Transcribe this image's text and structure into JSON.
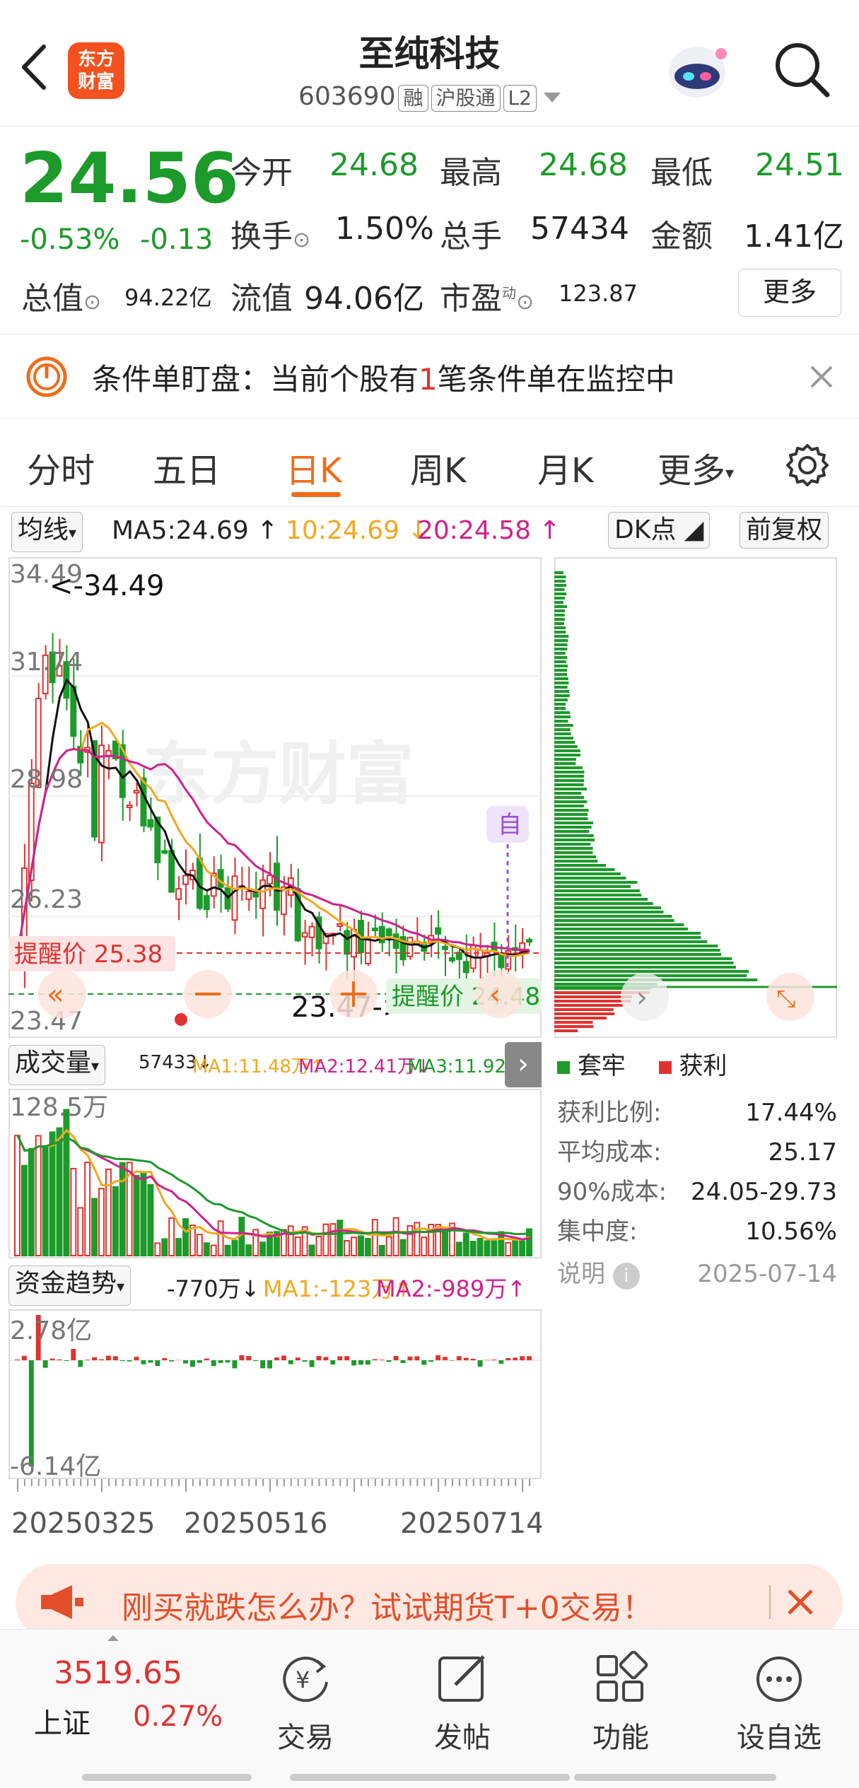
{
  "header": {
    "title": "至纯科技",
    "code": "603690",
    "tags": [
      "融",
      "沪股通",
      "L2"
    ],
    "logo_text": "东方财富"
  },
  "quote": {
    "price": "24.56",
    "pct": "-0.53%",
    "chg": "-0.13",
    "open_label": "今开",
    "open": "24.68",
    "high_label": "最高",
    "high": "24.68",
    "low_label": "最低",
    "low": "24.51",
    "turnover_label": "换手",
    "turnover": "1.50%",
    "volume_label": "总手",
    "volume": "57434",
    "amount_label": "金额",
    "amount": "1.41亿",
    "mcap_label": "总值",
    "mcap": "94.22亿",
    "float_label": "流值",
    "float": "94.06亿",
    "pe_label": "市盈",
    "pe_sup": "动",
    "pe": "123.87",
    "more_button": "更多"
  },
  "alert": {
    "prefix": "条件单盯盘：当前个股有",
    "count": "1",
    "suffix": "笔条件单在监控中"
  },
  "tabs": [
    {
      "label": "分时"
    },
    {
      "label": "五日"
    },
    {
      "label": "日K"
    },
    {
      "label": "周K"
    },
    {
      "label": "月K"
    },
    {
      "label": "更多"
    }
  ],
  "ma_row": {
    "selector": "均线",
    "ma5": "MA5:24.69",
    "ma10": "10:24.69",
    "ma20": "20:24.58",
    "dk": "DK点",
    "fq": "前复权"
  },
  "kline": {
    "y_labels": [
      "34.49",
      "31.74",
      "28.98",
      "26.23",
      "23.47"
    ],
    "high_marker": "<-34.49",
    "low_marker": "23.47->",
    "remind_left": "提醒价 25.38",
    "remind_right": "提醒价 24.48",
    "self_tag": "自"
  },
  "volume": {
    "selector": "成交量",
    "value": "57433",
    "ma1": "MA1:11.48万",
    "ma2": "MA2:12.41万",
    "ma3": "MA3:11.92万",
    "max_label": "128.5万"
  },
  "fund": {
    "selector": "资金趋势",
    "value": "-770万",
    "ma1": "MA1:-123万",
    "ma2": "MA2:-989万",
    "top_label": "2.78亿",
    "bottom_label": "-6.14亿"
  },
  "dates": [
    "20250325",
    "20250516",
    "20250714"
  ],
  "chip": {
    "legend_trapped": "套牢",
    "legend_profit": "获利",
    "rows": [
      {
        "label": "获利比例:",
        "value": "17.44%"
      },
      {
        "label": "平均成本:",
        "value": "25.17"
      },
      {
        "label": "90%成本:",
        "value": "24.05-29.73"
      },
      {
        "label": "集中度:",
        "value": "10.56%"
      }
    ],
    "note_label": "说明",
    "note_date": "2025-07-14"
  },
  "promo": {
    "text": "刚买就跌怎么办？试试期货T+0交易！"
  },
  "bottom": {
    "index_value": "3519.65",
    "index_name": "上证",
    "index_pct": "0.27%",
    "nav": [
      {
        "label": "交易"
      },
      {
        "label": "发帖"
      },
      {
        "label": "功能"
      },
      {
        "label": "设自选"
      }
    ]
  },
  "colors": {
    "up": "#e0322f",
    "down": "#1c9a2a",
    "accent": "#ef6c1a",
    "ma10": "#f2a81d",
    "ma20": "#d0208e"
  }
}
